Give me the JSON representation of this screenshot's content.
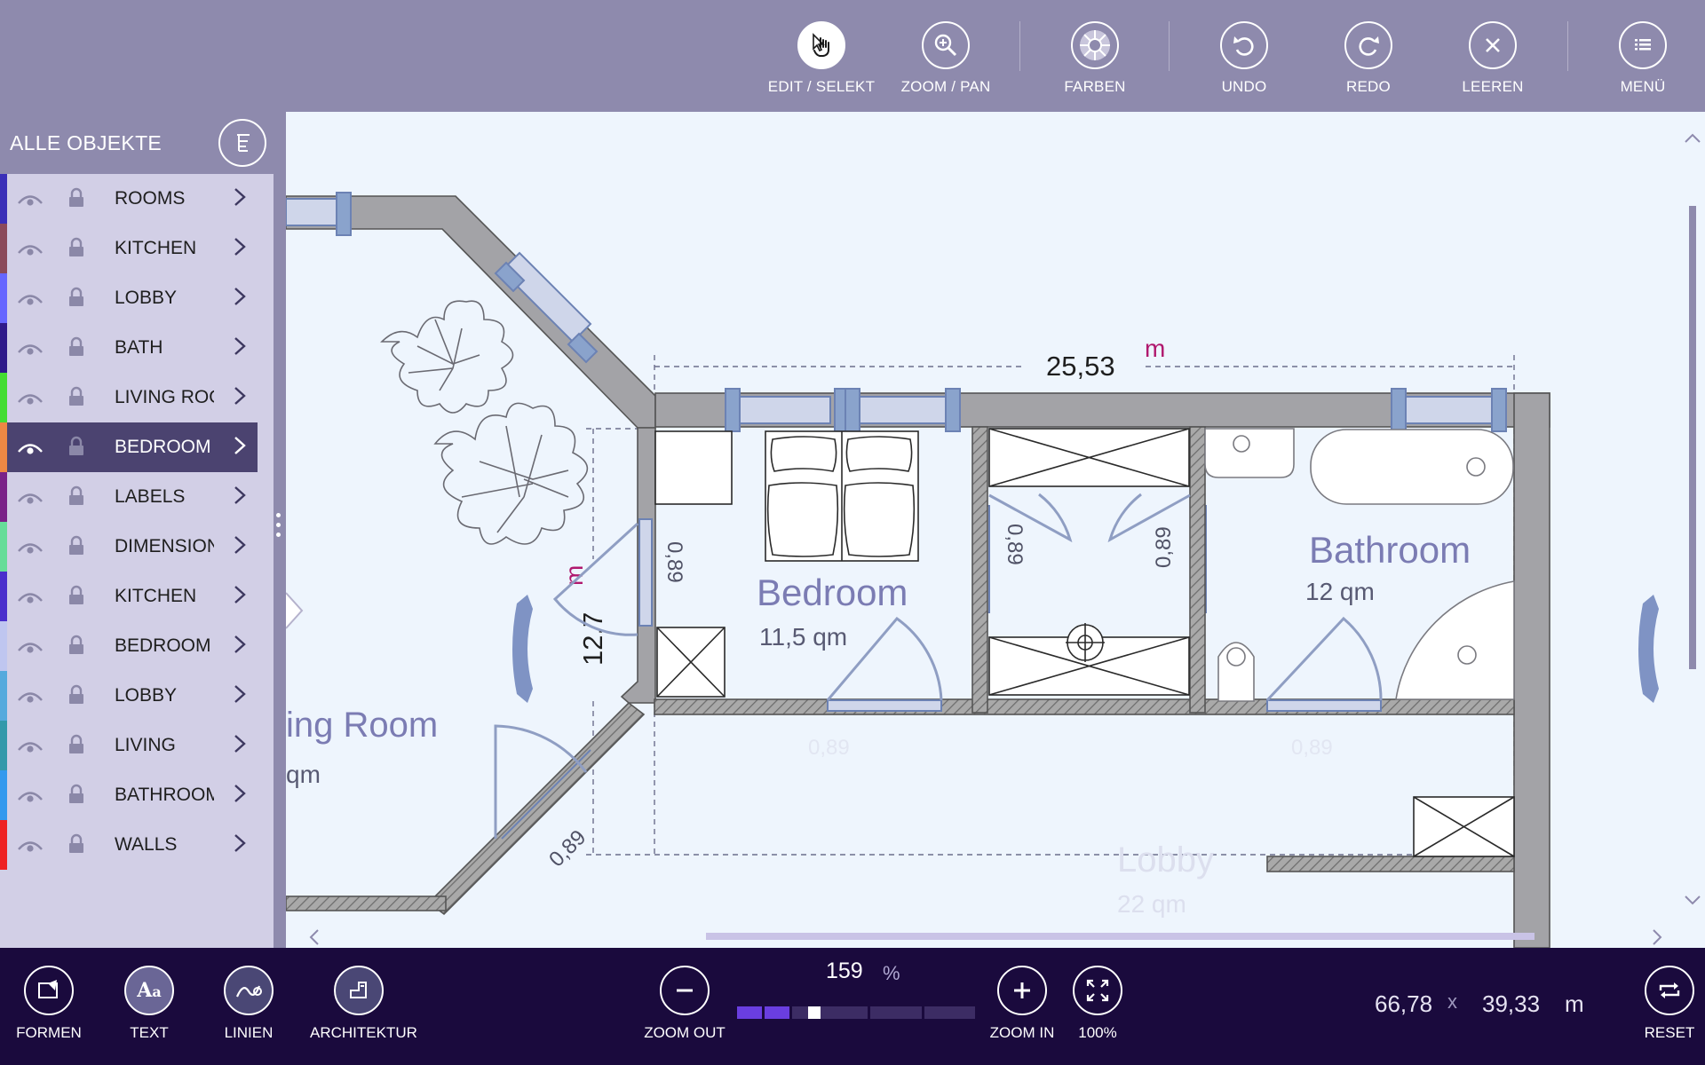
{
  "toolbar": {
    "buttons": [
      {
        "label": "EDIT / SELEKT",
        "icon": "hand-pointer-icon"
      },
      {
        "label": "ZOOM / PAN",
        "icon": "zoom-icon"
      },
      {
        "label": "FARBEN",
        "icon": "palette-icon"
      },
      {
        "label": "UNDO",
        "icon": "undo-icon"
      },
      {
        "label": "REDO",
        "icon": "redo-icon"
      },
      {
        "label": "LEEREN",
        "icon": "clear-icon"
      },
      {
        "label": "MENÜ",
        "icon": "menu-icon"
      }
    ]
  },
  "panel": {
    "title": "ALLE OBJEKTE",
    "layers": [
      {
        "name": "ROOMS",
        "color": "#3a2fb8"
      },
      {
        "name": "KITCHEN",
        "color": "#8b4a5a"
      },
      {
        "name": "LOBBY",
        "color": "#6666ff"
      },
      {
        "name": "BATH",
        "color": "#2f1a8a"
      },
      {
        "name": "LIVING ROOM",
        "color": "#44dd33"
      },
      {
        "name": "BEDROOM",
        "color": "#ee8844",
        "selected": true
      },
      {
        "name": "LABELS",
        "color": "#7a2288"
      },
      {
        "name": "DIMENSIONS",
        "color": "#66dd99"
      },
      {
        "name": "KITCHEN",
        "color": "#4a2fcc"
      },
      {
        "name": "BEDROOM",
        "color": "#bfc6f0"
      },
      {
        "name": "LOBBY",
        "color": "#55aadd"
      },
      {
        "name": "LIVING",
        "color": "#3399aa"
      },
      {
        "name": "BATHROOM",
        "color": "#3399ee"
      },
      {
        "name": "WALLS",
        "color": "#ee2222"
      }
    ]
  },
  "plan": {
    "dimension_top": "25,53",
    "dimension_top_unit": "m",
    "dimension_left": "12,7",
    "dimension_left_unit": "m",
    "door_width": "0,89",
    "rooms": [
      {
        "name": "Bedroom",
        "area": "11,5 qm"
      },
      {
        "name": "Bathroom",
        "area": "12 qm"
      },
      {
        "name": "ing Room",
        "area": "qm"
      },
      {
        "name": "Lobby",
        "area": "22 qm"
      }
    ]
  },
  "bottombar": {
    "buttons": [
      {
        "label": "FORMEN",
        "icon": "shapes-icon"
      },
      {
        "label": "TEXT",
        "icon": "text-icon"
      },
      {
        "label": "LINIEN",
        "icon": "lines-icon"
      },
      {
        "label": "ARCHITEKTUR",
        "icon": "architecture-icon"
      }
    ],
    "zoom_out": "ZOOM OUT",
    "zoom_in": "ZOOM IN",
    "fit": "100%",
    "reset": "RESET",
    "zoom_value": "159",
    "zoom_unit": "%",
    "zoom_level": 0.3,
    "coord_x": "66,78",
    "coord_sep": "x",
    "coord_y": "39,33",
    "coord_unit": "m"
  },
  "colors": {
    "accent": "#8e8aad",
    "dark": "#1a0a3d",
    "panel": "#d2cfe6",
    "selected": "#4b4370",
    "dimension_unit": "#b0186e",
    "room_label": "#7b7cb3"
  }
}
